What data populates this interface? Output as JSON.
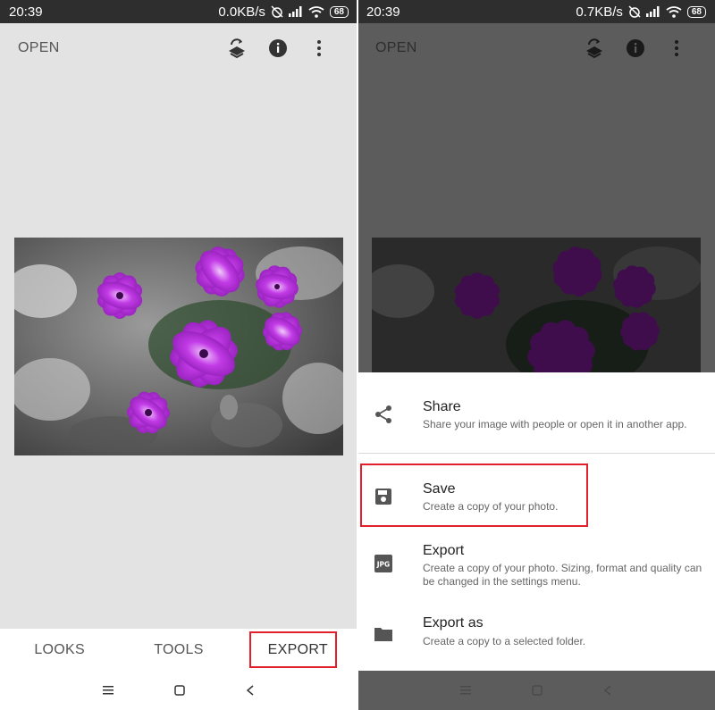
{
  "left": {
    "status": {
      "time": "20:39",
      "speed": "0.0KB/s",
      "battery": "68"
    },
    "appbar": {
      "open_label": "OPEN"
    },
    "tabs": [
      {
        "label": "LOOKS"
      },
      {
        "label": "TOOLS"
      },
      {
        "label": "EXPORT"
      }
    ]
  },
  "right": {
    "status": {
      "time": "20:39",
      "speed": "0.7KB/s",
      "battery": "68"
    },
    "appbar": {
      "open_label": "OPEN"
    },
    "sheet": {
      "items": [
        {
          "title": "Share",
          "desc": "Share your image with people or open it in another app.",
          "icon": "share-icon"
        },
        {
          "title": "Save",
          "desc": "Create a copy of your photo.",
          "icon": "save-icon"
        },
        {
          "title": "Export",
          "desc": "Create a copy of your photo. Sizing, format and quality can be changed in the settings menu.",
          "icon": "jpg-icon",
          "icon_text": "JPG"
        },
        {
          "title": "Export as",
          "desc": "Create a copy to a selected folder.",
          "icon": "folder-icon"
        }
      ]
    }
  },
  "colors": {
    "highlight": "#e0202a",
    "flower": "#b424d8"
  }
}
